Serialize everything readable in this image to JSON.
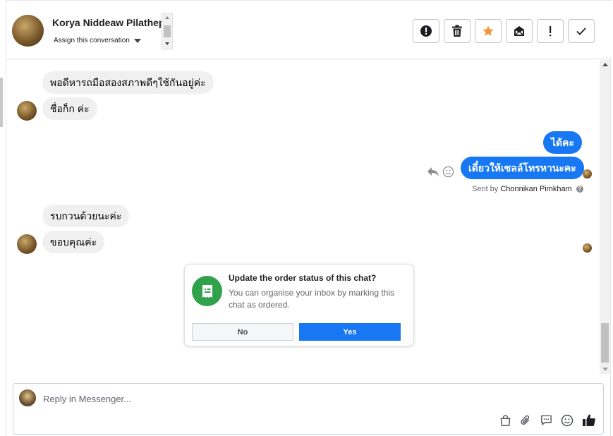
{
  "header": {
    "contact_name": "Korya Niddeaw Pilathep",
    "assign_label": "Assign this conversation"
  },
  "toolbar": {
    "icons": [
      "alert-circle-icon",
      "trash-icon",
      "star-icon",
      "mark-unread-icon",
      "exclamation-icon",
      "checkmark-icon"
    ],
    "star_color": "#f7923a"
  },
  "messages": {
    "m1": "พอดีหารถมือสองสภาพดีๆใช้กันอยู่ค่ะ",
    "m2": "ชื่อก็ก ค่ะ",
    "m3": "ได้คะ",
    "m4": "เดี๋ยวให้เซลล์โทรหานะคะ",
    "m5": "รบกวนด้วยนะค่ะ",
    "m6": "ขอบคุณค่ะ"
  },
  "sent_by": {
    "prefix": "Sent by",
    "agent": "Chonnikan Pimkham"
  },
  "order_card": {
    "title": "Update the order status of this chat?",
    "description": "You can organise your inbox by marking this chat as ordered.",
    "no_label": "No",
    "yes_label": "Yes"
  },
  "composer": {
    "placeholder": "Reply in Messenger...",
    "value": "",
    "tools": [
      "shopping-bag-icon",
      "paperclip-icon",
      "saved-reply-icon",
      "emoji-icon",
      "thumbs-up-icon"
    ]
  },
  "colors": {
    "accent": "#1877f2",
    "order_green": "#31a24c",
    "bubble_in": "#f0f0f0"
  }
}
